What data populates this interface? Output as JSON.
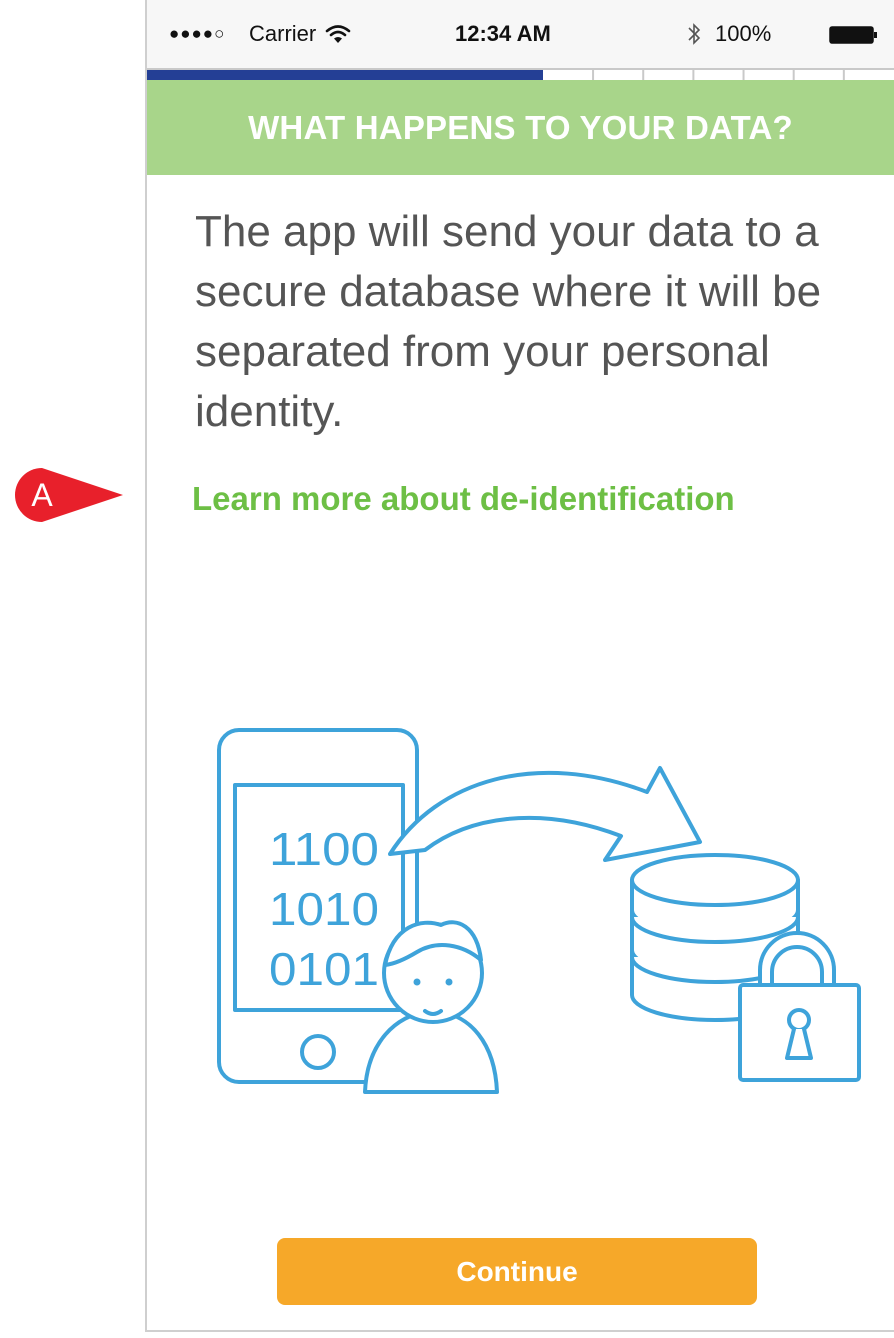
{
  "annotation": {
    "label": "A",
    "color": "#e8202b"
  },
  "status_bar": {
    "signal": "●●●●○",
    "carrier": "Carrier",
    "time": "12:34 AM",
    "battery_percent": "100%",
    "icons": [
      "wifi-icon",
      "bluetooth-icon",
      "battery-icon"
    ]
  },
  "progress": {
    "fraction": 0.53,
    "steps": 13,
    "fill_color": "#243f95"
  },
  "header": {
    "title": "WHAT HAPPENS TO YOUR DATA?",
    "color": "#a8d58a"
  },
  "content": {
    "body": "The app will send your data to a secure database where it will be separated from your personal identity.",
    "link": "Learn more about de-identification",
    "link_color": "#6dbf45"
  },
  "illustration": {
    "binary_lines": [
      "1100",
      "1010",
      "0101"
    ],
    "icons": [
      "phone-icon",
      "person-icon",
      "arrow-icon",
      "database-icon",
      "lock-icon"
    ],
    "stroke_color": "#3ea3da"
  },
  "footer": {
    "continue_label": "Continue",
    "button_color": "#f6a829"
  }
}
